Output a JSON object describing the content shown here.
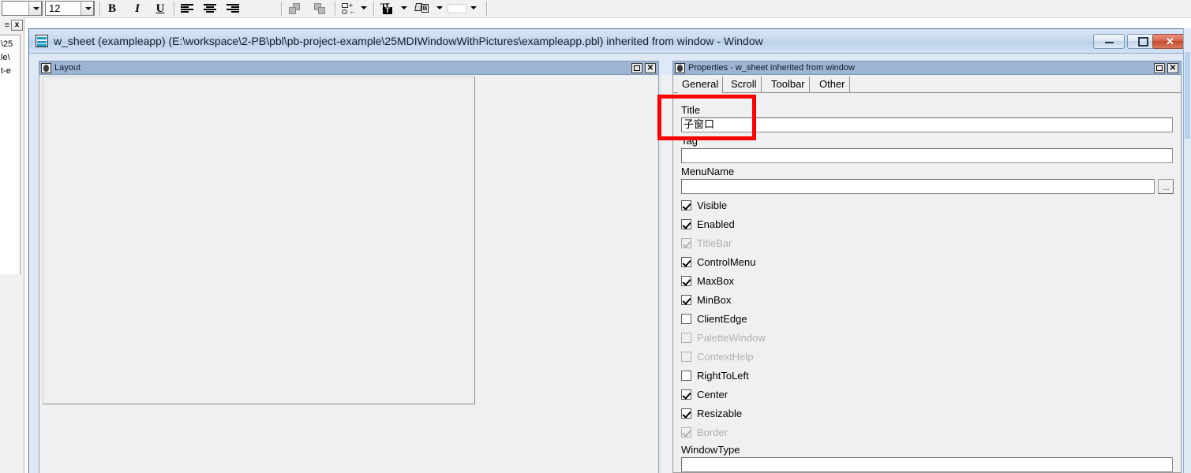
{
  "toolbar": {
    "font_combo_value": "",
    "size_combo_value": "12",
    "buttons": [
      {
        "name": "bold-button",
        "label": "B"
      },
      {
        "name": "italic-button",
        "label": "I"
      },
      {
        "name": "underline-button",
        "label": "U"
      }
    ],
    "align_buttons": [
      {
        "name": "align-left-button",
        "label": "Align Left"
      },
      {
        "name": "align-center-button",
        "label": "Align Center"
      },
      {
        "name": "align-right-button",
        "label": "Align Right"
      }
    ],
    "group_buttons": [
      {
        "name": "bring-to-front-button",
        "label": "Bring To Front"
      },
      {
        "name": "send-to-back-button",
        "label": "Send To Back"
      }
    ],
    "dropdown_buttons": [
      {
        "name": "insert-control-dropdown",
        "label": "Insert Control"
      },
      {
        "name": "text-color-dropdown",
        "label": "Text Color"
      },
      {
        "name": "fill-color-dropdown",
        "label": "Background Color"
      },
      {
        "name": "color-swatch-dropdown",
        "label": "Color"
      }
    ]
  },
  "left_stub": {
    "close_label": "x",
    "menu_label": "≡",
    "lines": [
      "\\25",
      "le\\",
      "t-e"
    ]
  },
  "window": {
    "title": "w_sheet (exampleapp) (E:\\workspace\\2-PB\\pbl\\pb-project-example\\25MDIWindowWithPictures\\exampleapp.pbl) inherited from window - Window",
    "minimize_label": "Minimize",
    "maximize_label": "Maximize",
    "close_label": "✕"
  },
  "layout_panel": {
    "title": "Layout",
    "maximize_label": "Maximize",
    "close_label": "✕"
  },
  "properties_panel": {
    "title": "Properties - w_sheet inherited from window",
    "maximize_label": "Maximize",
    "close_label": "✕",
    "tabs": [
      {
        "label": "General",
        "selected": true
      },
      {
        "label": "Scroll",
        "selected": false
      },
      {
        "label": "Toolbar",
        "selected": false
      },
      {
        "label": "Other",
        "selected": false
      }
    ],
    "fields": [
      {
        "label": "Title",
        "value": "子窗口",
        "has_ellipsis": false
      },
      {
        "label": "Tag",
        "value": "",
        "has_ellipsis": false
      },
      {
        "label": "MenuName",
        "value": "",
        "has_ellipsis": true,
        "ellipsis_label": "..."
      }
    ],
    "checkboxes": [
      {
        "label": "Visible",
        "checked": true,
        "enabled": true
      },
      {
        "label": "Enabled",
        "checked": true,
        "enabled": true
      },
      {
        "label": "TitleBar",
        "checked": true,
        "enabled": false
      },
      {
        "label": "ControlMenu",
        "checked": true,
        "enabled": true
      },
      {
        "label": "MaxBox",
        "checked": true,
        "enabled": true
      },
      {
        "label": "MinBox",
        "checked": true,
        "enabled": true
      },
      {
        "label": "ClientEdge",
        "checked": false,
        "enabled": true
      },
      {
        "label": "PaletteWindow",
        "checked": false,
        "enabled": false
      },
      {
        "label": "ContextHelp",
        "checked": false,
        "enabled": false
      },
      {
        "label": "RightToLeft",
        "checked": false,
        "enabled": true
      },
      {
        "label": "Center",
        "checked": true,
        "enabled": true
      },
      {
        "label": "Resizable",
        "checked": true,
        "enabled": true
      },
      {
        "label": "Border",
        "checked": true,
        "enabled": false
      }
    ],
    "trailing_label": "WindowType"
  },
  "annotation": {
    "highlight_color": "#ff0000",
    "highlight_target": "Title field"
  }
}
